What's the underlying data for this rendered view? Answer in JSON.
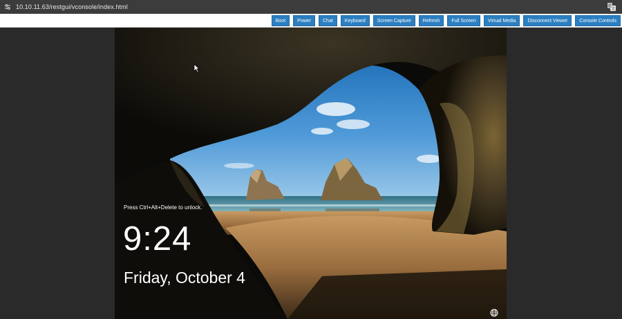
{
  "browser": {
    "url": "10.10.11.63/restgui/vconsole/index.html",
    "icons": [
      "tune-icon",
      "translate-icon"
    ]
  },
  "toolbar": {
    "buttons": [
      {
        "label": "Boot"
      },
      {
        "label": "Power"
      },
      {
        "label": "Chat"
      },
      {
        "label": "Keyboard"
      },
      {
        "label": "Screen Capture"
      },
      {
        "label": "Refresh"
      },
      {
        "label": "Full Screen"
      },
      {
        "label": "Virtual Media"
      },
      {
        "label": "Disconnect Viewer"
      },
      {
        "label": "Console Controls"
      }
    ],
    "accent": "#2c7fc0"
  },
  "lockscreen": {
    "hint": "Press Ctrl+Alt+Delete to unlock.",
    "time": "9:24",
    "date": "Friday, October 4",
    "icons": [
      "globe-icon",
      "cursor-icon"
    ]
  }
}
